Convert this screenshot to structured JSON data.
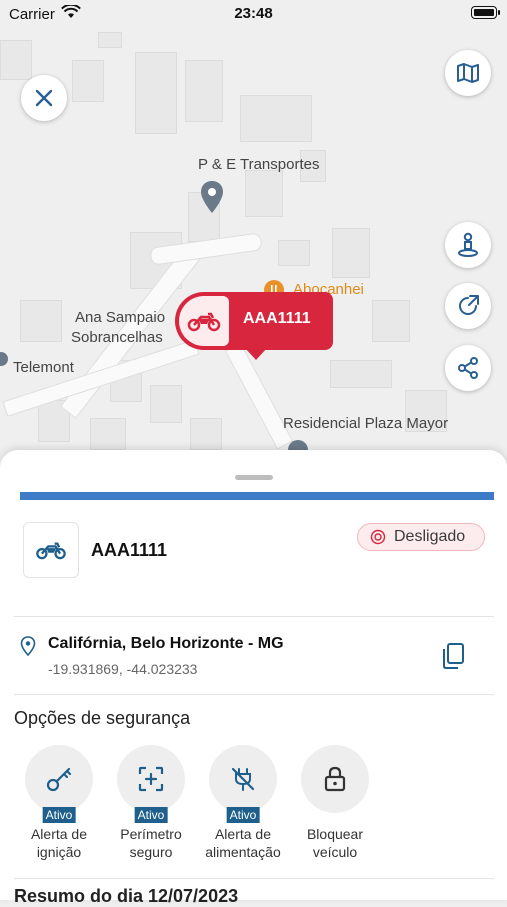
{
  "status_bar": {
    "carrier": "Carrier",
    "time": "23:48"
  },
  "map": {
    "labels": {
      "pe_transportes": "P & E Transportes",
      "abocanhei": "Abocanhei",
      "ana_sampaio_line1": "Ana Sampaio",
      "ana_sampaio_line2": "Sobrancelhas",
      "telemont": "Telemont",
      "residencial": "Residencial Plaza Mayor"
    },
    "marker": {
      "plate": "AAA1111",
      "icon": "motorcycle-icon"
    },
    "buttons": [
      "close-icon",
      "map-icon",
      "street-view-icon",
      "share-external-icon",
      "share-icon"
    ]
  },
  "sheet": {
    "vehicle": {
      "plate": "AAA1111",
      "icon": "motorcycle-icon"
    },
    "status_badge": {
      "label": "Desligado",
      "color": "#d7263d"
    },
    "accent_color": "#3f7ac6",
    "location": {
      "address": "Califórnia, Belo Horizonte - MG",
      "coords": "-19.931869, -44.023233"
    },
    "security": {
      "title": "Opções de segurança",
      "options": [
        {
          "line1": "Alerta de",
          "line2": "ignição",
          "tag": "Ativo",
          "icon": "key-icon"
        },
        {
          "line1": "Perímetro",
          "line2": "seguro",
          "tag": "Ativo",
          "icon": "perimeter-icon"
        },
        {
          "line1": "Alerta de",
          "line2": "alimentação",
          "tag": "Ativo",
          "icon": "power-off-icon"
        },
        {
          "line1": "Bloquear",
          "line2": "veículo",
          "tag": "",
          "icon": "lock-icon"
        }
      ]
    },
    "summary_title": "Resumo do dia 12/07/2023"
  }
}
